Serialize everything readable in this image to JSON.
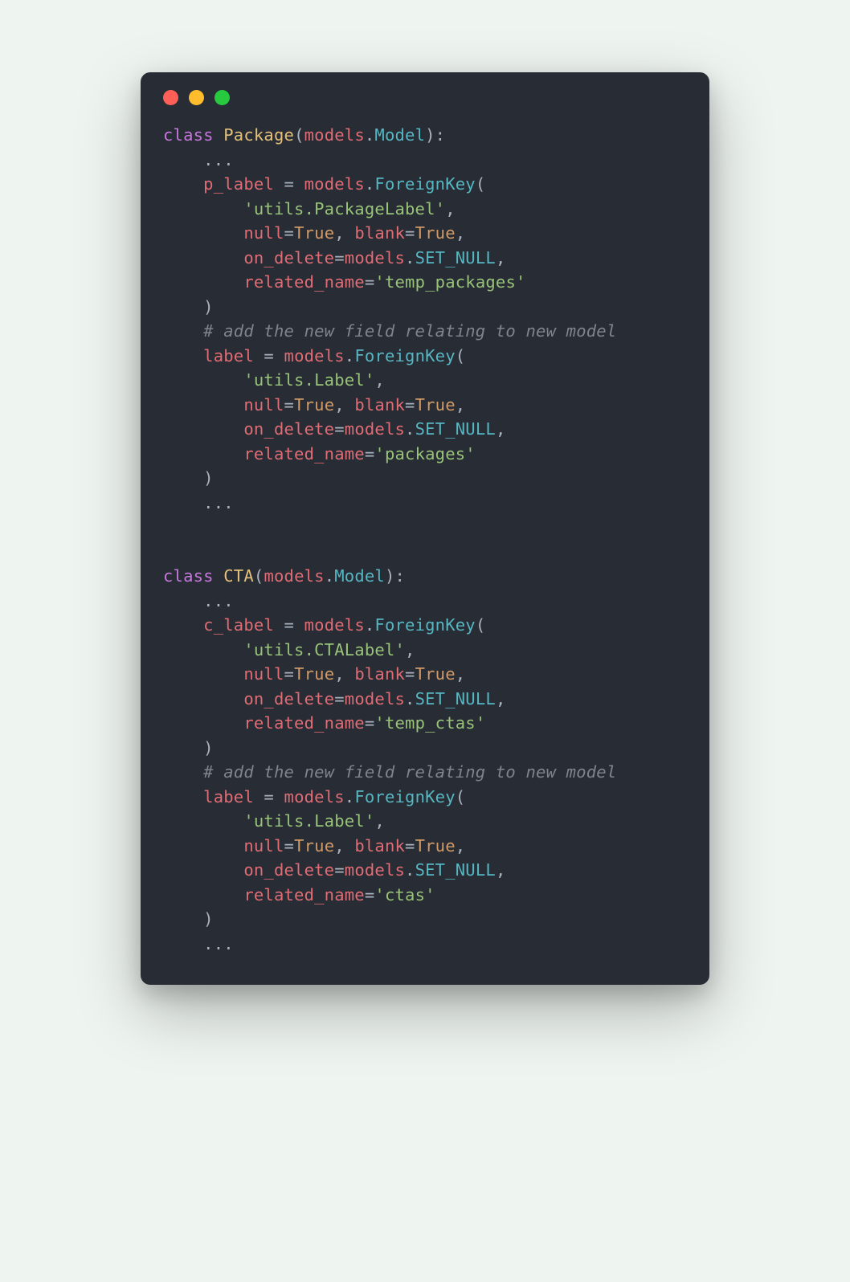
{
  "window": {
    "traffic_lights": [
      "close",
      "minimize",
      "zoom"
    ]
  },
  "code": {
    "package": {
      "class_kw": "class",
      "class_name": "Package",
      "models_name": "models",
      "model_attr": "Model",
      "ellipsis": "...",
      "p_label": "p_label",
      "eq": " = ",
      "foreignkey": "ForeignKey",
      "str_pkg_label": "'utils.PackageLabel'",
      "null_kw": "null",
      "blank_kw": "blank",
      "true_val": "True",
      "on_delete_kw": "on_delete",
      "set_null": "SET_NULL",
      "related_name_kw": "related_name",
      "rn_temp_packages": "'temp_packages'",
      "comment": "# add the new field relating to new model",
      "label_name": "label",
      "str_label": "'utils.Label'",
      "rn_packages": "'packages'"
    },
    "cta": {
      "class_kw": "class",
      "class_name": "CTA",
      "models_name": "models",
      "model_attr": "Model",
      "ellipsis": "...",
      "c_label": "c_label",
      "foreignkey": "ForeignKey",
      "str_cta_label": "'utils.CTALabel'",
      "null_kw": "null",
      "blank_kw": "blank",
      "true_val": "True",
      "on_delete_kw": "on_delete",
      "set_null": "SET_NULL",
      "related_name_kw": "related_name",
      "rn_temp_ctas": "'temp_ctas'",
      "comment": "# add the new field relating to new model",
      "label_name": "label",
      "str_label": "'utils.Label'",
      "rn_ctas": "'ctas'"
    }
  }
}
